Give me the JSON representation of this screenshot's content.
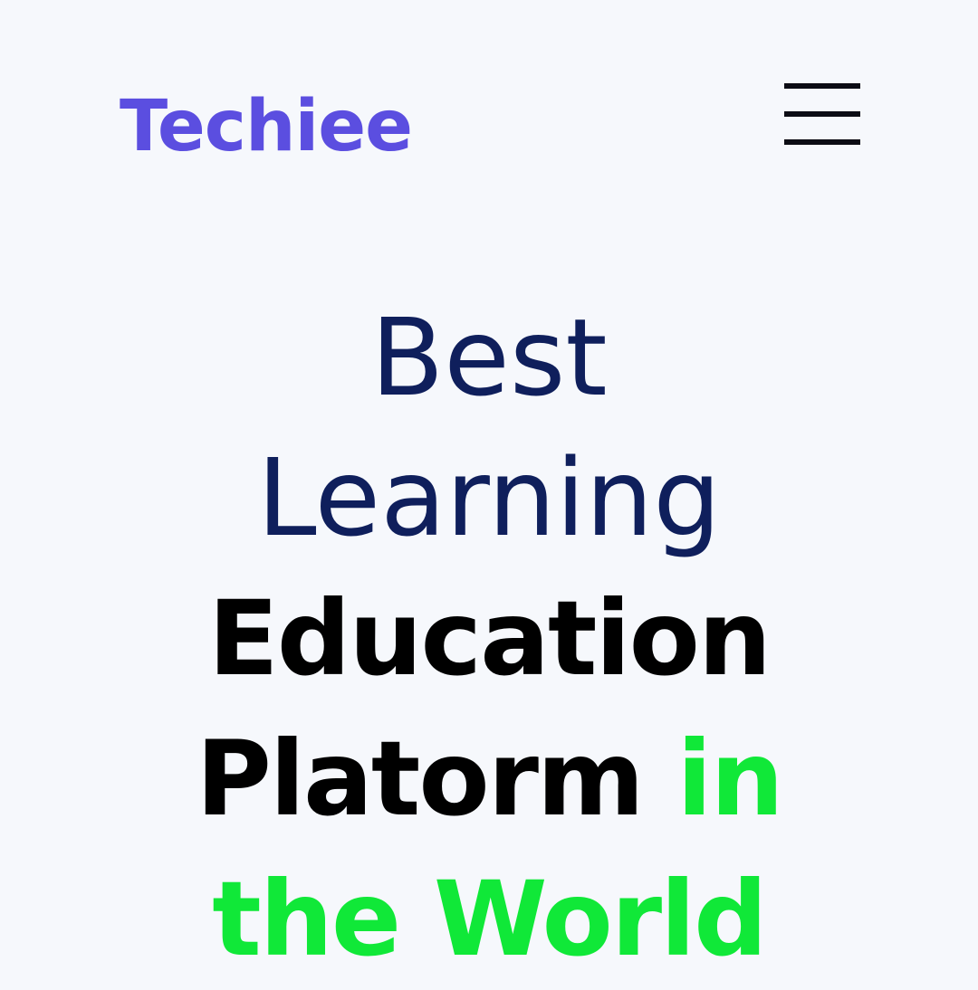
{
  "header": {
    "logo_text": "Techiee",
    "menu_icon": "hamburger-menu-icon"
  },
  "hero": {
    "line1": "Best",
    "line2": "Learning",
    "line3": "Education",
    "line4_main": "Platorm",
    "line4_accent": "in",
    "line5_accent": "the World"
  },
  "colors": {
    "logo": "#5b4ee0",
    "heading_light": "#0f1f5c",
    "heading_bold": "#000000",
    "accent": "#10e838",
    "background": "#f6f8fc"
  }
}
